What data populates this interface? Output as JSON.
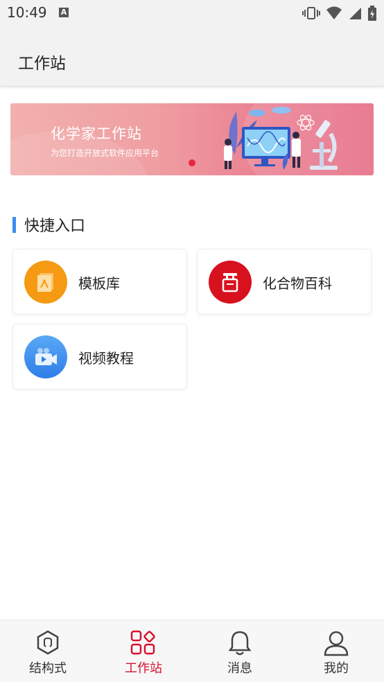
{
  "status_bar": {
    "time": "10:49",
    "notification_icon": "A",
    "icons": [
      "vibrate-icon",
      "wifi-icon",
      "signal-icon",
      "battery-icon"
    ]
  },
  "app_bar": {
    "title": "工作站"
  },
  "banner": {
    "title": "化学家工作站",
    "subtitle": "为您打造开放式软件应用平台",
    "active_dot_color": "#e8283b"
  },
  "quick_entry": {
    "title": "快捷入口",
    "items": [
      {
        "label": "模板库",
        "icon": "template-icon",
        "color": "#f59a12"
      },
      {
        "label": "化合物百科",
        "icon": "book-icon",
        "color": "#d8111e"
      },
      {
        "label": "视频教程",
        "icon": "video-camera-icon",
        "color": "#2f8af0"
      }
    ]
  },
  "bottom_nav": {
    "items": [
      {
        "label": "结构式",
        "icon": "hexagon-icon",
        "active": false
      },
      {
        "label": "工作站",
        "icon": "grid-icon",
        "active": true
      },
      {
        "label": "消息",
        "icon": "bell-icon",
        "active": false
      },
      {
        "label": "我的",
        "icon": "user-icon",
        "active": false
      }
    ],
    "active_color": "#d8112e"
  }
}
